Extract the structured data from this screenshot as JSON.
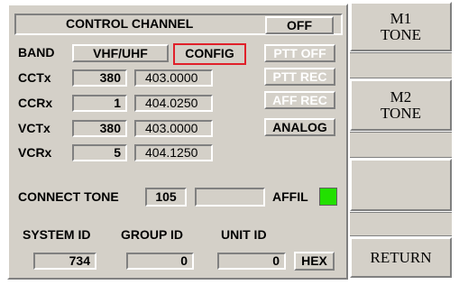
{
  "header": {
    "title": "CONTROL CHANNEL",
    "state": "OFF"
  },
  "band": {
    "label": "BAND",
    "value": "VHF/UHF",
    "config_button": "CONFIG"
  },
  "side_buttons": {
    "ptt_off": "PTT OFF",
    "ptt_rec": "PTT REC",
    "aff_rec": "AFF REC",
    "analog": "ANALOG"
  },
  "channels": [
    {
      "label": "CCTx",
      "number": "380",
      "freq": "403.0000"
    },
    {
      "label": "CCRx",
      "number": "1",
      "freq": "404.0250"
    },
    {
      "label": "VCTx",
      "number": "380",
      "freq": "403.0000"
    },
    {
      "label": "VCRx",
      "number": "5",
      "freq": "404.1250"
    }
  ],
  "connect_tone": {
    "label": "CONNECT TONE",
    "value": "105",
    "extra": ""
  },
  "affil": {
    "label": "AFFIL",
    "indicator_color": "#22e000"
  },
  "ids": {
    "system_label": "SYSTEM ID",
    "system_value": "734",
    "group_label": "GROUP ID",
    "group_value": "0",
    "unit_label": "UNIT ID",
    "unit_value": "0",
    "hex_button": "HEX"
  },
  "right_panel": {
    "m1": "M1\nTONE",
    "m2": "M2\nTONE",
    "blank": "",
    "return": "RETURN"
  }
}
